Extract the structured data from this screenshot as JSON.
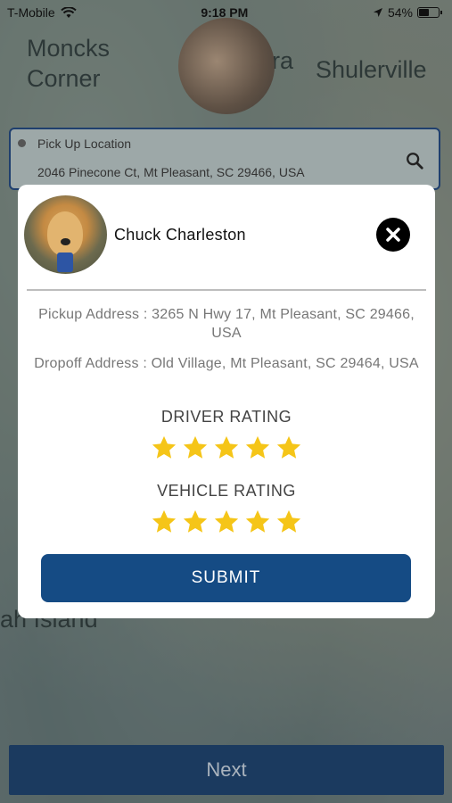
{
  "status_bar": {
    "carrier": "T-Mobile",
    "time": "9:18 PM",
    "battery": "54%",
    "battery_level": 0.54
  },
  "map": {
    "labels": [
      {
        "text": "Moncks\nCorner"
      },
      {
        "text": "Shulerville"
      },
      {
        "text": "ra"
      },
      {
        "text": "ah Island"
      }
    ]
  },
  "pickup": {
    "label": "Pick Up Location",
    "value": "2046 Pinecone Ct, Mt Pleasant, SC 29466, USA"
  },
  "next_button": {
    "label": "Next"
  },
  "modal": {
    "driver_name": "Chuck Charleston",
    "pickup_address": "Pickup Address : 3265 N Hwy 17, Mt Pleasant, SC 29466, USA",
    "dropoff_address": "Dropoff Address : Old Village, Mt Pleasant, SC 29464, USA",
    "driver_rating_title": "DRIVER RATING",
    "driver_rating": 5,
    "vehicle_rating_title": "VEHICLE RATING",
    "vehicle_rating": 5,
    "submit_label": "SUBMIT"
  },
  "colors": {
    "star": "#f5c518",
    "submit_bg": "#154b84",
    "next_bg": "#1b3a5f"
  },
  "icons": [
    "wifi-icon",
    "location-arrow-icon",
    "battery-icon",
    "search-icon",
    "close-icon",
    "star-icon"
  ]
}
